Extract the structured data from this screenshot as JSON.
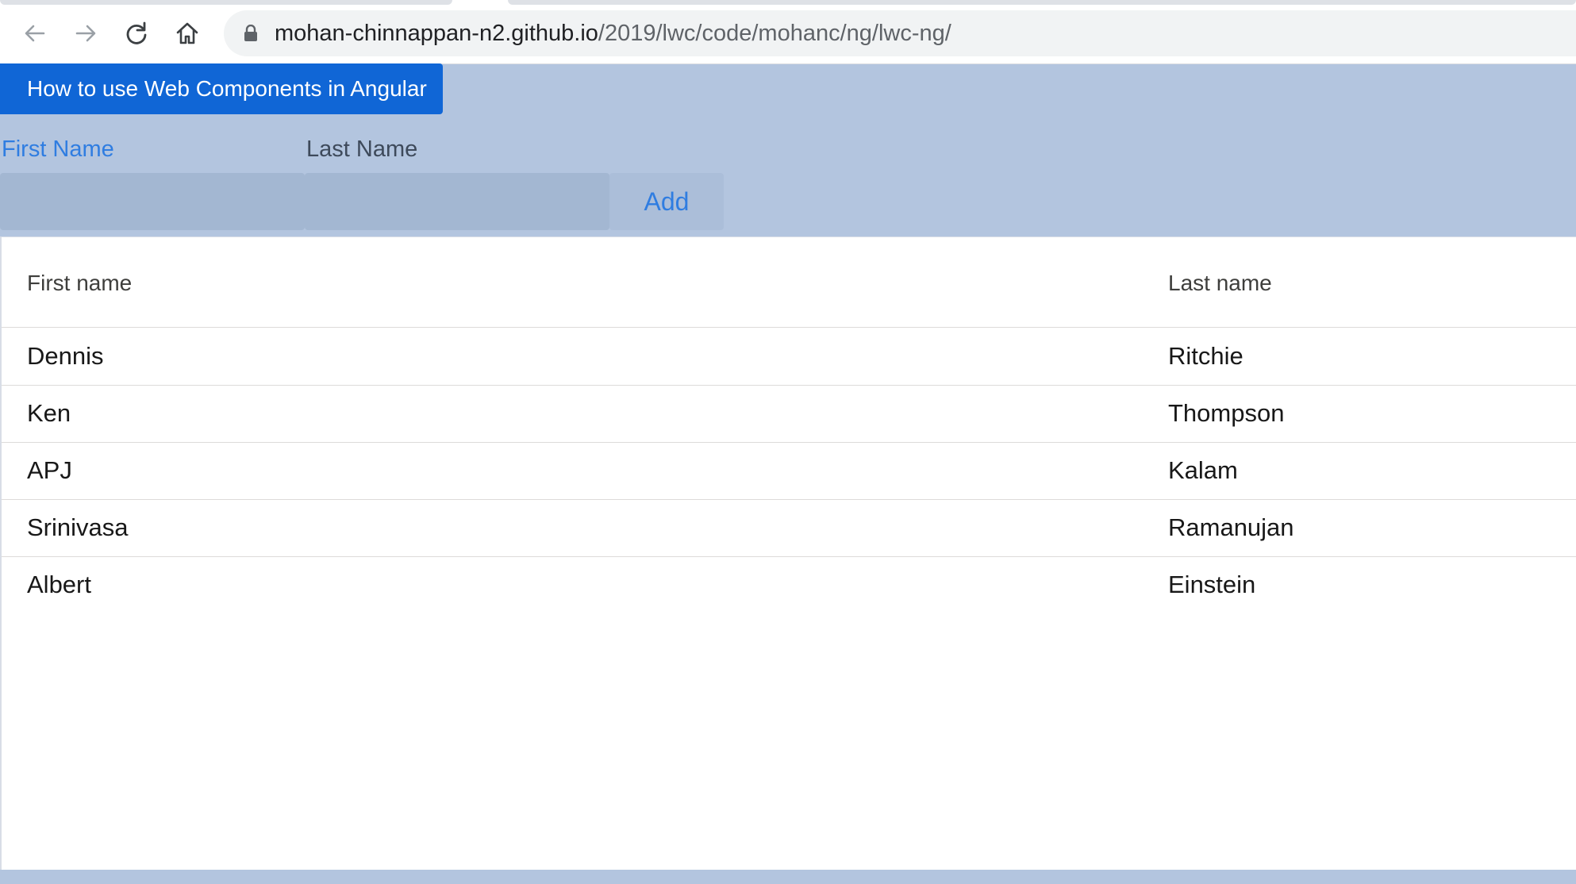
{
  "browser": {
    "url_host": "mohan-chinnappan-n2.github.io",
    "url_path": "/2019/lwc/code/mohanc/ng/lwc-ng/",
    "icons": [
      "back-arrow-icon",
      "forward-arrow-icon",
      "reload-icon",
      "home-icon",
      "lock-icon"
    ]
  },
  "page": {
    "header_button": "How to use Web Components in Angular",
    "form": {
      "first_name_label": "First Name",
      "last_name_label": "Last Name",
      "first_name_value": "",
      "last_name_value": "",
      "add_button": "Add"
    },
    "table": {
      "headers": [
        "First name",
        "Last name"
      ],
      "rows": [
        [
          "Dennis",
          "Ritchie"
        ],
        [
          "Ken",
          "Thompson"
        ],
        [
          "APJ",
          "Kalam"
        ],
        [
          "Srinivasa",
          "Ramanujan"
        ],
        [
          "Albert",
          "Einstein"
        ]
      ]
    }
  },
  "colors": {
    "page_background": "#b3c5df",
    "brand_button": "#1066d6",
    "link_blue": "#2f7de1"
  }
}
